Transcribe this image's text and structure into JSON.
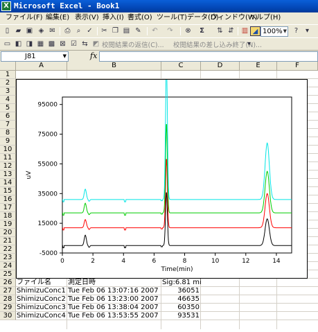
{
  "window": {
    "title": "Microsoft Excel - Book1",
    "app_icon": "X"
  },
  "menu": [
    "ファイル(F)",
    "編集(E)",
    "表示(V)",
    "挿入(I)",
    "書式(O)",
    "ツール(T)",
    "データ(D)",
    "ウィンドウ(W)",
    "ヘルプ(H)"
  ],
  "toolbar": {
    "zoom": "100%",
    "review_reply": "校閲結果の返信(C)...",
    "review_end": "校閲結果の差し込み終了(N)..."
  },
  "formula_bar": {
    "name_box": "J81",
    "fx": "fx",
    "formula": ""
  },
  "columns": [
    "A",
    "B",
    "C",
    "D",
    "E",
    "F"
  ],
  "rows": [
    "1",
    "2",
    "3",
    "4",
    "5",
    "6",
    "7",
    "8",
    "9",
    "10",
    "11",
    "12",
    "13",
    "14",
    "15",
    "16",
    "17",
    "18",
    "19",
    "20",
    "21",
    "22",
    "23",
    "24",
    "25",
    "26",
    "27",
    "28",
    "29",
    "30"
  ],
  "table": {
    "headers": [
      "ファイル名",
      "測定日時",
      "Sig:6.81 min"
    ],
    "rows": [
      [
        "ShimizuConc1",
        "Tue Feb 06 13:07:16 2007",
        "36051"
      ],
      [
        "ShimizuConc2",
        "Tue Feb 06 13:23:00 2007",
        "46635"
      ],
      [
        "ShimizuConc3",
        "Tue Feb 06 13:38:04 2007",
        "60350"
      ],
      [
        "ShimizuConc4",
        "Tue Feb 06 13:53:55 2007",
        "93531"
      ]
    ]
  },
  "chart_data": {
    "type": "line",
    "xlabel": "Time(min)",
    "ylabel": "uV",
    "xlim": [
      0,
      15
    ],
    "ylim": [
      -5000,
      100000
    ],
    "xticks": [
      0,
      2,
      4,
      6,
      8,
      10,
      12,
      14
    ],
    "yticks": [
      -5000,
      15000,
      35000,
      55000,
      75000,
      95000
    ],
    "grid": false,
    "series": [
      {
        "color": "#000000",
        "baseline": 0,
        "peaks": [
          [
            1.5,
            7000
          ],
          [
            6.81,
            36051
          ],
          [
            13.4,
            18000
          ]
        ]
      },
      {
        "color": "#ff0000",
        "baseline": 12000,
        "peaks": [
          [
            1.5,
            5500
          ],
          [
            6.81,
            46635
          ],
          [
            13.4,
            23000
          ]
        ]
      },
      {
        "color": "#00cc00",
        "baseline": 22000,
        "peaks": [
          [
            1.5,
            6500
          ],
          [
            6.81,
            60350
          ],
          [
            13.4,
            28000
          ]
        ]
      },
      {
        "color": "#00e5e5",
        "baseline": 31000,
        "peaks": [
          [
            1.5,
            7000
          ],
          [
            6.81,
            93531
          ],
          [
            13.4,
            38000
          ]
        ]
      }
    ]
  }
}
